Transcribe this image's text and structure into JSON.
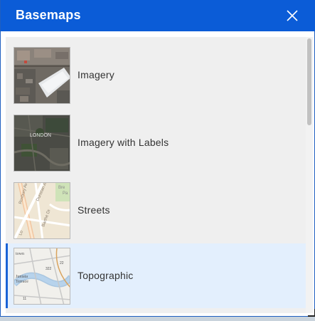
{
  "header": {
    "title": "Basemaps"
  },
  "icons": {
    "close": "close-icon",
    "resize": "resize-handle-icon"
  },
  "colors": {
    "header_bg": "#0b5cd7",
    "selected_bg": "#e3effd",
    "selected_accent": "#1a63d6"
  },
  "basemaps": [
    {
      "label": "Imagery",
      "selected": false
    },
    {
      "label": "Imagery with Labels",
      "selected": false
    },
    {
      "label": "Streets",
      "selected": false
    },
    {
      "label": "Topographic",
      "selected": true
    }
  ],
  "thumbnail_text": {
    "imagery_labels": "LONDON",
    "streets": [
      "Bre",
      "Pa",
      "Roxbury Av",
      "Dunstan Ave",
      "Barthe Dr",
      "Lo"
    ],
    "topographic": [
      "town",
      "Juniata",
      "Terrace",
      "22",
      "322",
      "11"
    ]
  }
}
